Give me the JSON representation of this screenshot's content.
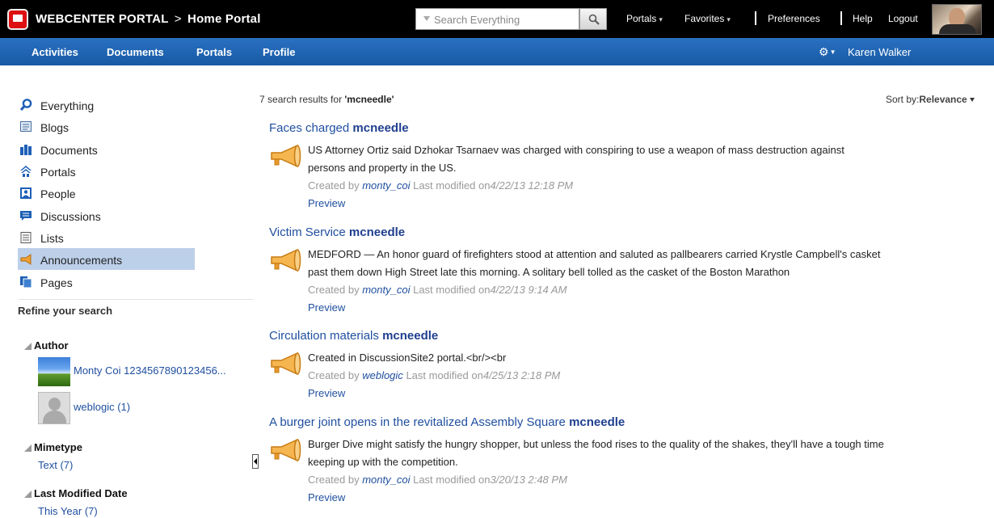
{
  "header": {
    "app_name": "WEBCENTER PORTAL",
    "separator": ">",
    "portal_name": "Home Portal",
    "search_placeholder": "Search Everything",
    "links": {
      "portals": "Portals",
      "favorites": "Favorites",
      "preferences": "Preferences",
      "help": "Help",
      "logout": "Logout"
    }
  },
  "nav": {
    "tabs": [
      "Activities",
      "Documents",
      "Portals",
      "Profile"
    ],
    "user": "Karen Walker"
  },
  "sidebar": {
    "items": [
      {
        "label": "Everything",
        "icon": "search-icon"
      },
      {
        "label": "Blogs",
        "icon": "blog-icon"
      },
      {
        "label": "Documents",
        "icon": "documents-icon"
      },
      {
        "label": "Portals",
        "icon": "portals-icon"
      },
      {
        "label": "People",
        "icon": "people-icon"
      },
      {
        "label": "Discussions",
        "icon": "discussions-icon"
      },
      {
        "label": "Lists",
        "icon": "lists-icon"
      },
      {
        "label": "Announcements",
        "icon": "announcement-icon",
        "selected": true
      },
      {
        "label": "Pages",
        "icon": "pages-icon"
      }
    ],
    "refine_title": "Refine your search",
    "facets": {
      "author": {
        "title": "Author",
        "values": [
          "Monty Coi 1234567890123456...",
          "weblogic (1)"
        ]
      },
      "mimetype": {
        "title": "Mimetype",
        "values": [
          "Text (7)"
        ]
      },
      "modified": {
        "title": "Last Modified Date",
        "values": [
          "This Year (7)"
        ]
      }
    }
  },
  "results": {
    "count": "7",
    "count_text": "search results for",
    "query": "'mcneedle'",
    "sort_label": "Sort by:",
    "sort_value": "Relevance",
    "items": [
      {
        "title": "Faces charged",
        "highlight": "mcneedle",
        "line1": "US Attorney Ortiz said Dzhokar Tsarnaev was charged with conspiring to use a weapon of mass destruction against",
        "line2": "persons and property in the US.",
        "created_by": "Created by",
        "author": "monty_coi",
        "modified_label": "Last modified on",
        "modified": "4/22/13 12:18 PM",
        "preview": "Preview"
      },
      {
        "title": "Victim Service",
        "highlight": "mcneedle",
        "line1": "MEDFORD — An honor guard of firefighters stood at attention and saluted as pallbearers carried Krystle Campbell's casket",
        "line2": "past them down High Street late this morning. A solitary bell tolled as the casket of the Boston Marathon",
        "created_by": "Created by",
        "author": "monty_coi",
        "modified_label": "Last modified on",
        "modified": "4/22/13 9:14 AM",
        "preview": "Preview"
      },
      {
        "title": "Circulation materials",
        "highlight": "mcneedle",
        "line1": "Created in DiscussionSite2 portal.<br/><br",
        "line2": "",
        "created_by": "Created by",
        "author": "weblogic",
        "modified_label": "Last modified on",
        "modified": "4/25/13 2:18 PM",
        "preview": "Preview"
      },
      {
        "title": "A burger joint opens in the revitalized Assembly Square",
        "highlight": "mcneedle",
        "line1": "Burger Dive might satisfy the hungry shopper, but unless the food rises to the quality of the shakes, they'll have a tough time",
        "line2": "keeping up with the competition.",
        "created_by": "Created by",
        "author": "monty_coi",
        "modified_label": "Last modified on",
        "modified": "3/20/13 2:48 PM",
        "preview": "Preview"
      }
    ]
  },
  "colors": {
    "topbar": "#000000",
    "navbar": "#1f62b0",
    "link": "#1f4f9f",
    "selected": "#bdd0ea",
    "accent": "#f0a030"
  }
}
